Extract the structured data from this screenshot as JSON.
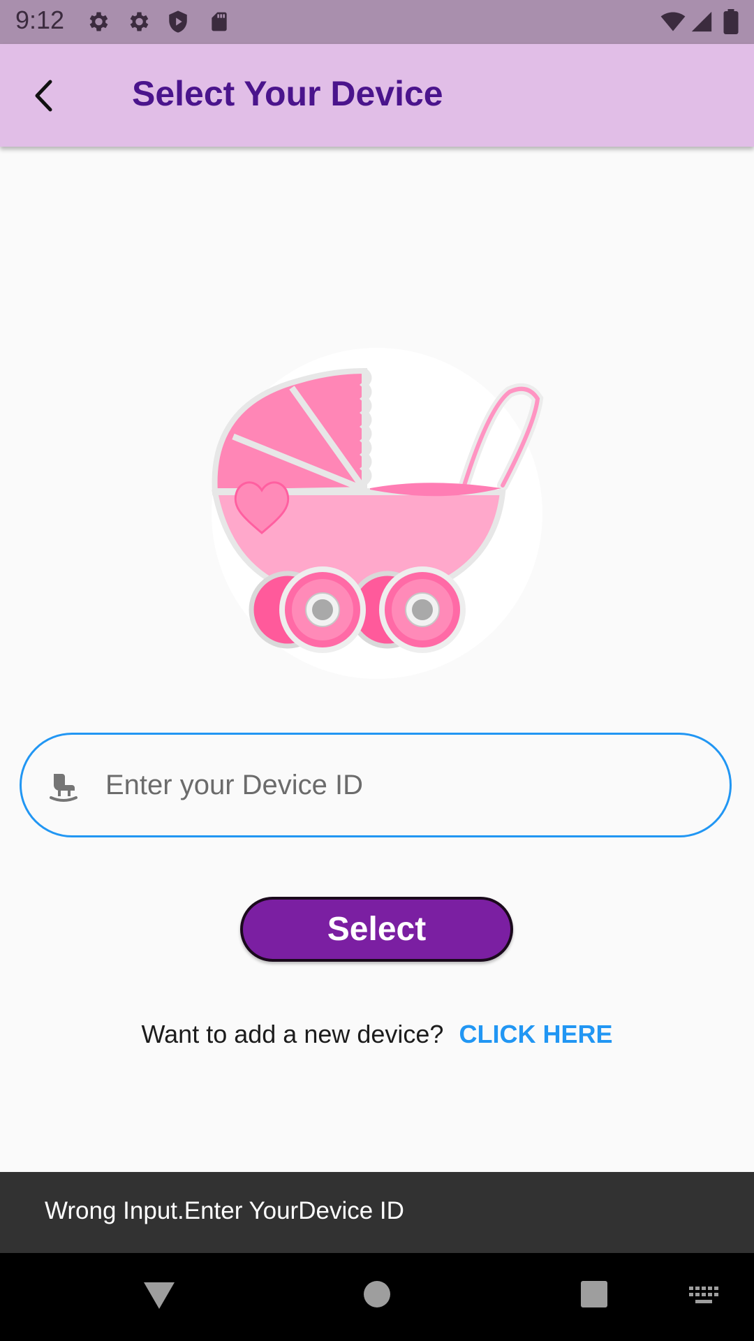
{
  "status_bar": {
    "time": "9:12",
    "left_icons": [
      "gear-icon",
      "gear-icon",
      "shield-play-icon",
      "sd-card-icon"
    ],
    "right_icons": [
      "wifi-icon",
      "signal-icon",
      "battery-icon"
    ]
  },
  "app_bar": {
    "title": "Select Your Device",
    "back_icon": "chevron-left-icon",
    "background": "#e1bee7",
    "title_color": "#4a148c"
  },
  "illustration": {
    "icon": "baby-stroller-icon"
  },
  "device_input": {
    "placeholder": "Enter your Device ID",
    "value": "",
    "icon": "rocking-chair-icon",
    "border_color": "#2196f3"
  },
  "select_button": {
    "label": "Select",
    "color": "#7b1fa2"
  },
  "add_device": {
    "prompt": "Want to add a new device?",
    "link_label": "CLICK HERE",
    "link_color": "#2196f3"
  },
  "snackbar": {
    "message": "Wrong Input.Enter YourDevice ID"
  },
  "nav_bar": {
    "buttons": [
      "back-triangle-icon",
      "home-circle-icon",
      "recents-square-icon",
      "keyboard-icon"
    ]
  }
}
